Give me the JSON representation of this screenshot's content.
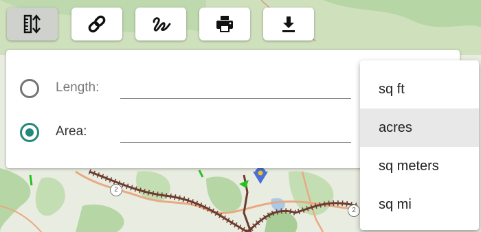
{
  "toolbar": {
    "buttons": [
      {
        "icon": "ruler-vertical-arrows-icon",
        "active": true
      },
      {
        "icon": "link-icon",
        "active": false
      },
      {
        "icon": "freehand-draw-icon",
        "active": false
      },
      {
        "icon": "printer-icon",
        "active": false
      },
      {
        "icon": "download-icon",
        "active": false
      }
    ]
  },
  "measure": {
    "length": {
      "label": "Length:",
      "value": "",
      "selected": false
    },
    "area": {
      "label": "Area:",
      "value": "",
      "selected": true
    }
  },
  "units_menu": {
    "items": [
      "sq ft",
      "acres",
      "sq meters",
      "sq mi"
    ],
    "highlighted": "acres"
  },
  "map": {
    "route_markers": [
      "2",
      "2"
    ]
  },
  "colors": {
    "accent": "#26877c",
    "map_base": "#e9ece0",
    "forest": "#b7d6a6",
    "road": "#e8a983",
    "trail": "#6b3b2e"
  }
}
